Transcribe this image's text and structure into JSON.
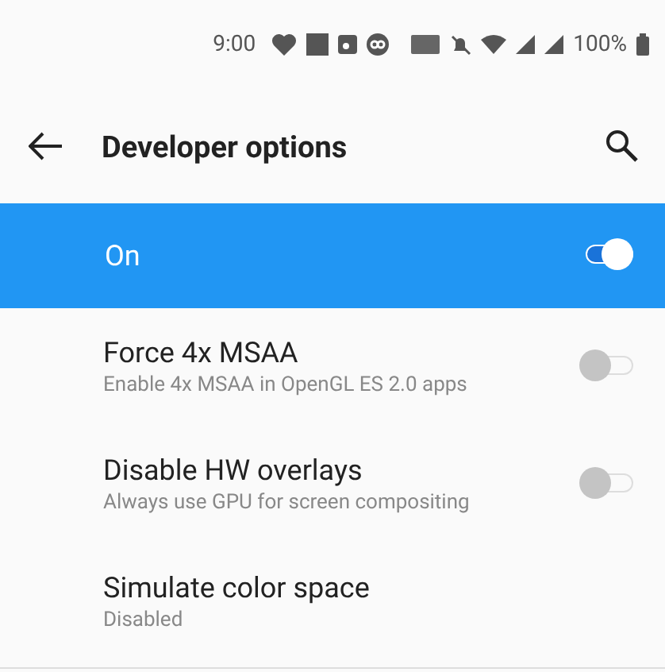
{
  "status_bar": {
    "time": "9:00",
    "battery": "100%"
  },
  "toolbar": {
    "title": "Developer options"
  },
  "master": {
    "label": "On",
    "on": true
  },
  "settings": [
    {
      "kind": "switch",
      "title": "Force 4x MSAA",
      "summary": "Enable 4x MSAA in OpenGL ES 2.0 apps",
      "on": false
    },
    {
      "kind": "switch",
      "title": "Disable HW overlays",
      "summary": "Always use GPU for screen compositing",
      "on": false
    },
    {
      "kind": "plain",
      "title": "Simulate color space",
      "summary": "Disabled"
    }
  ]
}
